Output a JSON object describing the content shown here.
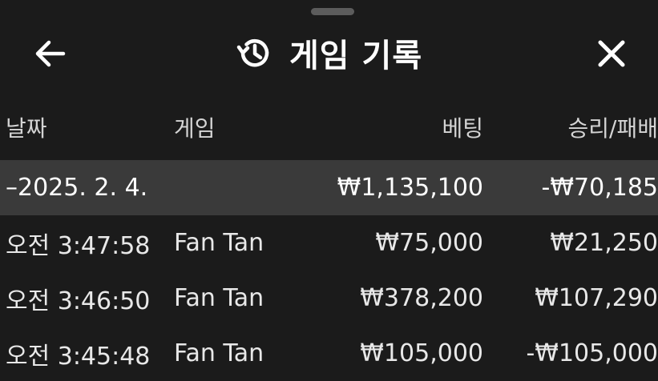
{
  "header": {
    "title": "게임 기록",
    "back_icon": "arrow-left-icon",
    "history_icon": "history-icon",
    "close_icon": "close-icon"
  },
  "table": {
    "columns": [
      "날짜",
      "게임",
      "베팅",
      "승리/패배"
    ],
    "group": {
      "date": "–2025. 2. 4.",
      "game": "",
      "bet": "₩1,135,100",
      "result": "-₩70,185"
    },
    "rows": [
      {
        "time": "오전 3:47:58",
        "game": "Fan Tan",
        "bet": "₩75,000",
        "result": "₩21,250"
      },
      {
        "time": "오전 3:46:50",
        "game": "Fan Tan",
        "bet": "₩378,200",
        "result": "₩107,290"
      },
      {
        "time": "오전 3:45:48",
        "game": "Fan Tan",
        "bet": "₩105,000",
        "result": "-₩105,000"
      }
    ]
  },
  "colors": {
    "background": "#1b1b1b",
    "group_row": "#3a3a3a",
    "text": "#ffffff",
    "header_text": "#d4d4d4"
  }
}
